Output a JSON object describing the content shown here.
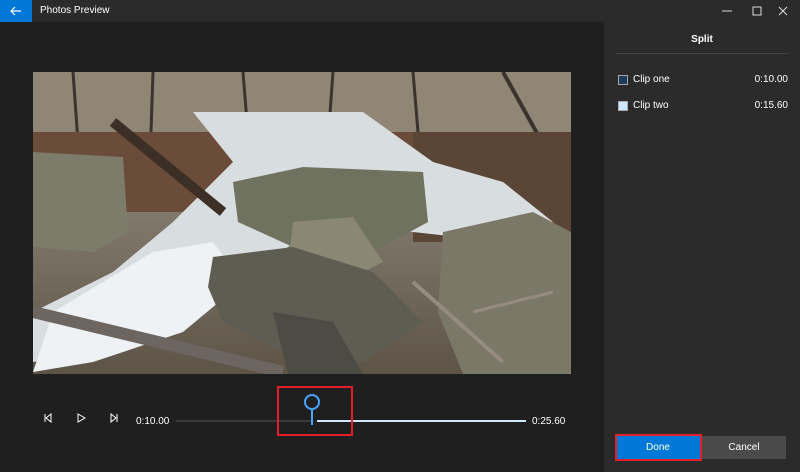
{
  "app": {
    "title": "Photos Preview"
  },
  "panel": {
    "title": "Split",
    "clips": [
      {
        "label": "Clip one",
        "time": "0:10.00",
        "color": "#1e3a5c"
      },
      {
        "label": "Clip two",
        "time": "0:15.60",
        "color": "#cfe7ff"
      }
    ],
    "done_label": "Done",
    "cancel_label": "Cancel"
  },
  "player": {
    "current_time": "0:10.00",
    "total_time": "0:25.60",
    "split_position_fraction": 0.39
  },
  "colors": {
    "accent": "#0078d7",
    "highlight": "#e3202a"
  },
  "icons": {
    "back": "arrow-left-icon",
    "minimize": "minimize-icon",
    "maximize": "maximize-icon",
    "close": "close-icon",
    "prev_frame": "previous-frame-icon",
    "play": "play-icon",
    "next_frame": "next-frame-icon",
    "split_handle": "split-handle-icon"
  }
}
